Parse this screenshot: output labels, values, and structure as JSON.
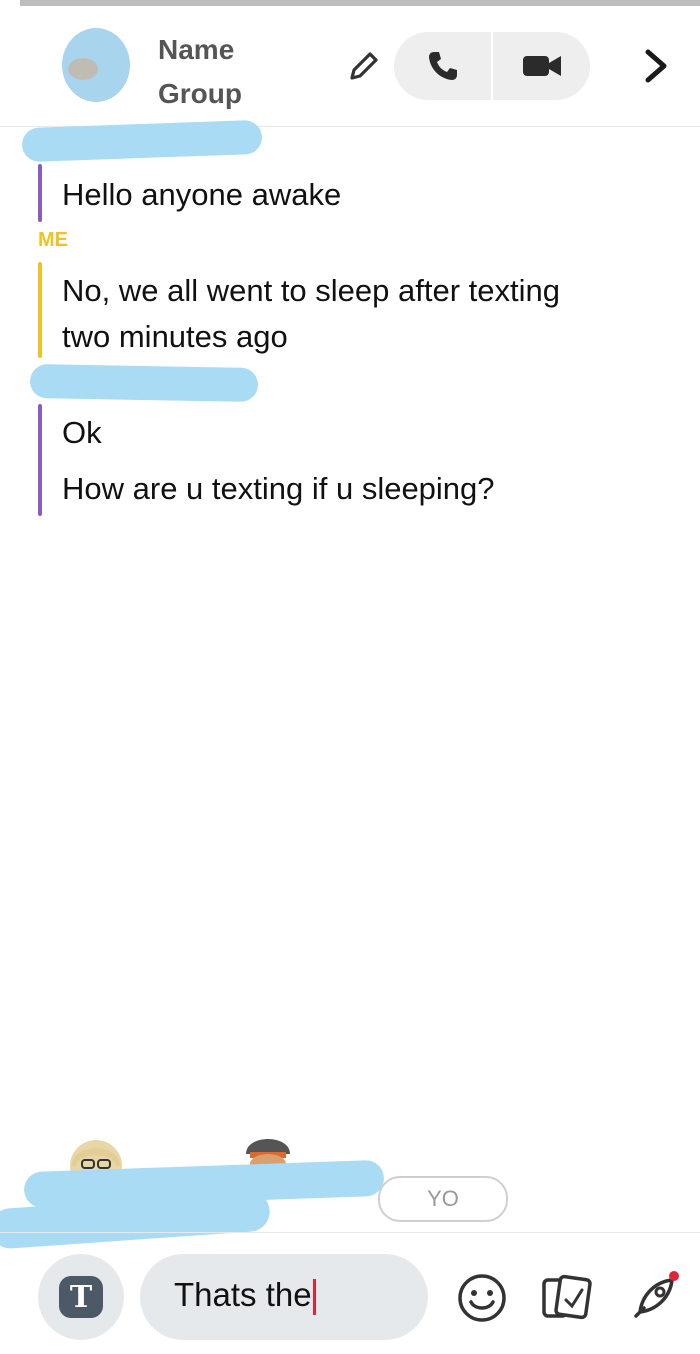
{
  "header": {
    "title_line1": "Name",
    "title_line2": "Group",
    "icons": [
      "avatar",
      "pencil-icon",
      "phone-icon",
      "video-camera-icon",
      "chevron-right-icon"
    ]
  },
  "messages": [
    {
      "sender": "",
      "sender_color": "#8a5cc2",
      "bar_color": "#8a5cc2",
      "lines": [
        "Hello anyone awake"
      ]
    },
    {
      "sender": "ME",
      "sender_color": "#f0c322",
      "bar_color": "#f0c322",
      "lines": [
        "No, we all went to sleep after texting",
        "two minutes ago"
      ]
    },
    {
      "sender": "",
      "sender_color": "#8a5cc2",
      "bar_color": "#8a5cc2",
      "lines": [
        "Ok",
        "How are u texting if u sleeping?"
      ]
    }
  ],
  "presence": {
    "chip_label": "YO"
  },
  "composer": {
    "input_value": "Thats the",
    "icons": [
      "text-mode-icon",
      "emoji-icon",
      "sticker-icon",
      "rocket-icon"
    ],
    "caret_color": "#e0253a"
  },
  "colors": {
    "scribble": "#a9dcf4",
    "me_accent": "#f0c322",
    "friend_accent": "#8a5cc2"
  }
}
